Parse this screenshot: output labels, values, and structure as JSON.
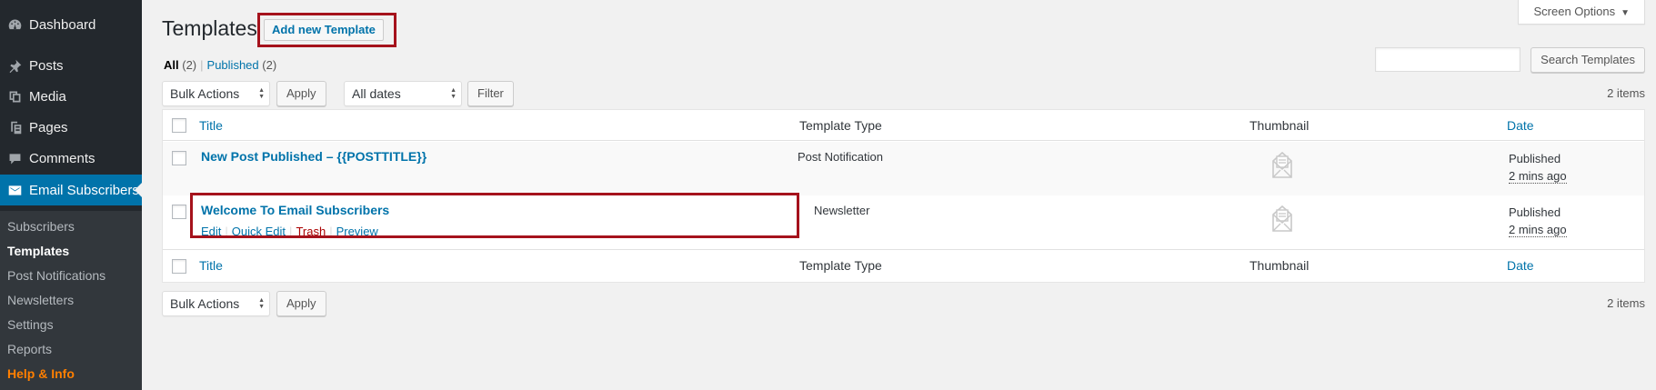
{
  "sidebar": {
    "items": [
      {
        "label": "Dashboard",
        "icon": "dashboard-icon"
      },
      {
        "label": "Posts",
        "icon": "pin-icon"
      },
      {
        "label": "Media",
        "icon": "media-icon"
      },
      {
        "label": "Pages",
        "icon": "pages-icon"
      },
      {
        "label": "Comments",
        "icon": "comment-icon"
      },
      {
        "label": "Email Subscribers",
        "icon": "envelope-icon"
      }
    ],
    "submenu": [
      "Subscribers",
      "Templates",
      "Post Notifications",
      "Newsletters",
      "Settings",
      "Reports",
      "Help & Info"
    ]
  },
  "header": {
    "title": "Templates",
    "add_new_label": "Add new Template",
    "screen_options_label": "Screen Options",
    "screen_options_caret": "▼"
  },
  "filters": {
    "all_label": "All",
    "all_count": "(2)",
    "separator": "|",
    "published_label": "Published",
    "published_count": "(2)"
  },
  "search": {
    "value": "",
    "button_label": "Search Templates"
  },
  "tablenav_top": {
    "bulk_actions": "Bulk Actions",
    "apply_label": "Apply",
    "dates": "All dates",
    "filter_label": "Filter",
    "items_count": "2 items"
  },
  "table": {
    "columns": {
      "title": "Title",
      "type": "Template Type",
      "thumbnail": "Thumbnail",
      "date": "Date"
    },
    "rows": [
      {
        "title": "New Post Published – {{POSTTITLE}}",
        "type": "Post Notification",
        "status": "Published",
        "ago": "2 mins ago"
      },
      {
        "title": "Welcome To Email Subscribers",
        "type": "Newsletter",
        "status": "Published",
        "ago": "2 mins ago",
        "actions": {
          "edit": "Edit",
          "quick_edit": "Quick Edit",
          "trash": "Trash",
          "preview": "Preview",
          "sep": "|"
        }
      }
    ]
  },
  "tablenav_bottom": {
    "bulk_actions": "Bulk Actions",
    "apply_label": "Apply",
    "items_count": "2 items"
  },
  "colors": {
    "sidebar_bg": "#23282d",
    "accent": "#0073aa",
    "highlight_border": "#a5121c",
    "help_orange": "#ff7f00",
    "trash_red": "#aa0000"
  }
}
